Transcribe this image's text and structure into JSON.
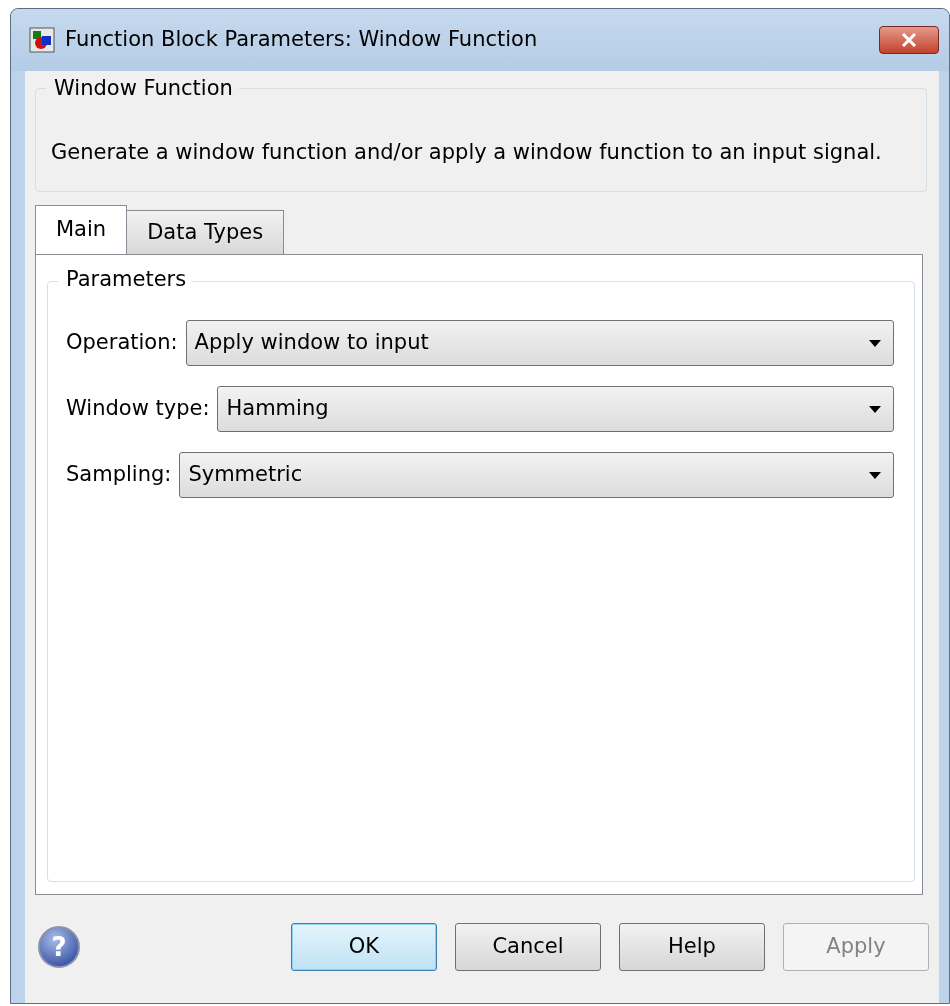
{
  "window": {
    "title": "Function Block Parameters: Window Function"
  },
  "description_group": {
    "title": "Window Function",
    "text": "Generate a window function and/or apply a window function to an input signal."
  },
  "tabs": [
    {
      "label": "Main",
      "selected": true
    },
    {
      "label": "Data Types",
      "selected": false
    }
  ],
  "parameters_group": {
    "title": "Parameters",
    "fields": [
      {
        "label": "Operation:",
        "value": "Apply window to input"
      },
      {
        "label": "Window type:",
        "value": "Hamming"
      },
      {
        "label": "Sampling:",
        "value": "Symmetric"
      }
    ]
  },
  "help_icon": {
    "glyph": "?"
  },
  "buttons": [
    {
      "label": "OK",
      "default": true,
      "disabled": false
    },
    {
      "label": "Cancel",
      "default": false,
      "disabled": false
    },
    {
      "label": "Help",
      "default": false,
      "disabled": false
    },
    {
      "label": "Apply",
      "default": false,
      "disabled": true
    }
  ]
}
